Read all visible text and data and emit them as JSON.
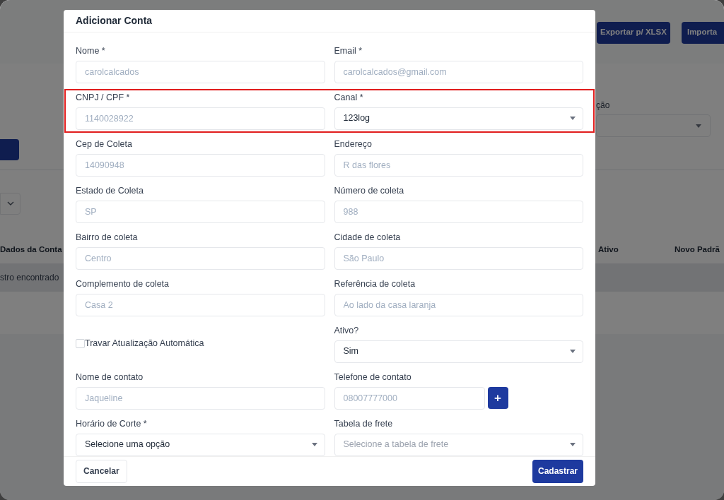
{
  "background": {
    "header_buttons": [
      "Exportar p/ XLSX",
      "Importa"
    ],
    "filter_label": "ção",
    "table": {
      "columns": [
        "Dados da Conta",
        "Ativo",
        "Novo Padrã"
      ],
      "empty_row": "stro encontrado"
    }
  },
  "dialog": {
    "title": "Adicionar Conta",
    "rows": [
      {
        "highlighted": false,
        "fields": [
          {
            "kind": "input",
            "label": "Nome *",
            "placeholder": "carolcalcados"
          },
          {
            "kind": "input",
            "label": "Email *",
            "placeholder": "carolcalcados@gmail.com"
          }
        ]
      },
      {
        "highlighted": true,
        "fields": [
          {
            "kind": "input",
            "label": "CNPJ / CPF *",
            "placeholder": "1140028922"
          },
          {
            "kind": "select",
            "label": "Canal *",
            "value": "123log"
          }
        ]
      },
      {
        "highlighted": false,
        "fields": [
          {
            "kind": "input",
            "label": "Cep de Coleta",
            "placeholder": "14090948"
          },
          {
            "kind": "input",
            "label": "Endereço",
            "placeholder": "R das flores"
          }
        ]
      },
      {
        "highlighted": false,
        "fields": [
          {
            "kind": "input",
            "label": "Estado de Coleta",
            "placeholder": "SP"
          },
          {
            "kind": "input",
            "label": "Número de coleta",
            "placeholder": "988"
          }
        ]
      },
      {
        "highlighted": false,
        "fields": [
          {
            "kind": "input",
            "label": "Bairro de coleta",
            "placeholder": "Centro"
          },
          {
            "kind": "input",
            "label": "Cidade de coleta",
            "placeholder": "São Paulo"
          }
        ]
      },
      {
        "highlighted": false,
        "fields": [
          {
            "kind": "input",
            "label": "Complemento de coleta",
            "placeholder": "Casa 2"
          },
          {
            "kind": "input",
            "label": "Referência de coleta",
            "placeholder": "Ao lado da casa laranja"
          }
        ]
      },
      {
        "highlighted": false,
        "fields": [
          {
            "kind": "checkbox",
            "label": "Travar Atualização Automática",
            "checked": false
          },
          {
            "kind": "select",
            "label": "Ativo?",
            "value": "Sim"
          }
        ]
      },
      {
        "highlighted": false,
        "fields": [
          {
            "kind": "input",
            "label": "Nome de contato",
            "placeholder": "Jaqueline"
          },
          {
            "kind": "phone",
            "label": "Telefone de contato",
            "placeholder": "08007777000",
            "button": "+"
          }
        ]
      },
      {
        "highlighted": false,
        "fields": [
          {
            "kind": "select",
            "label": "Horário de Corte *",
            "value": "Selecione uma opção"
          },
          {
            "kind": "select",
            "label": "Tabela de frete",
            "placeholder": "Selecione a tabela de frete"
          }
        ]
      }
    ],
    "buttons": {
      "cancel": "Cancelar",
      "submit": "Cadastrar"
    }
  }
}
